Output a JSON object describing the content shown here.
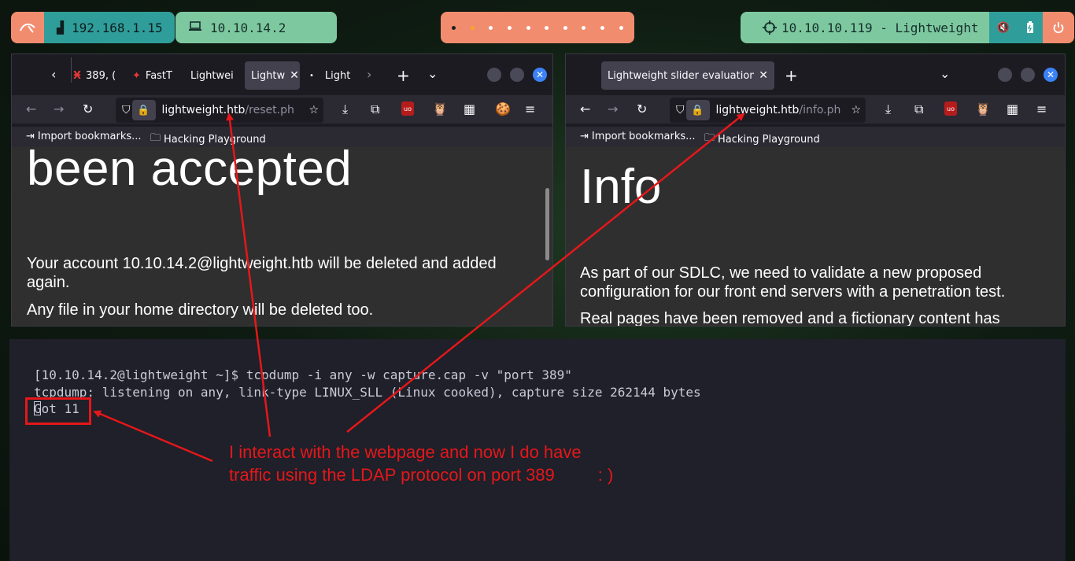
{
  "topbar": {
    "lan_ip": "192.168.1.15",
    "vpn_ip": "10.10.14.2",
    "target": "10.10.10.119 - Lightweight",
    "workspaces": [
      {
        "state": "normal"
      },
      {
        "state": "active"
      },
      {
        "state": "empty"
      },
      {
        "state": "empty"
      },
      {
        "state": "empty"
      },
      {
        "state": "empty"
      },
      {
        "state": "empty"
      },
      {
        "state": "empty"
      },
      {
        "state": "empty"
      },
      {
        "state": "empty"
      }
    ],
    "colors": {
      "salmon": "#f28c6f",
      "teal": "#2f9e9a",
      "mint": "#7ec8a0"
    }
  },
  "left_browser": {
    "tabs": [
      "389, (",
      "FastT",
      "Lightwei",
      "Lightw",
      "Light"
    ],
    "url_host": "lightweight.htb",
    "url_path": "/reset.ph",
    "bookmarks": [
      "Import bookmarks...",
      "Hacking Playground"
    ],
    "heading": "been accepted",
    "para1": "Your account 10.10.14.2@lightweight.htb will be deleted and added again.",
    "para2": "Any file in your home directory will be deleted too."
  },
  "right_browser": {
    "tab_title": "Lightweight slider evaluation p",
    "url_host": "lightweight.htb",
    "url_path": "/info.ph",
    "bookmarks": [
      "Import bookmarks...",
      "Hacking Playground"
    ],
    "heading": "Info",
    "para1": "As part of our SDLC, we need to validate a new proposed configuration for our front end servers with a penetration test.",
    "para2": "Real pages have been removed and a fictionary content has"
  },
  "terminal": {
    "line1": "[10.10.14.2@lightweight ~]$ tcpdump -i any -w capture.cap -v \"port 389\"",
    "line2": "tcpdump: listening on any, link-type LINUX_SLL (Linux cooked), capture size 262144 bytes",
    "line3": "Got 11"
  },
  "annotation": {
    "line1": "I interact with the webpage and now I do have",
    "line2": "traffic using the LDAP protocol on port 389         : )",
    "color": "#e5171a"
  }
}
